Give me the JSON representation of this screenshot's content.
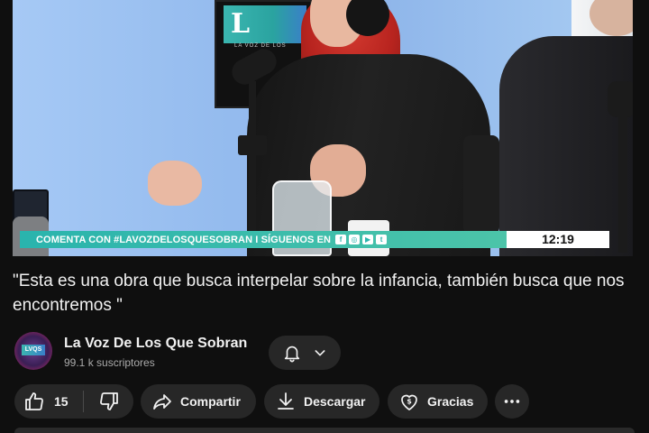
{
  "video": {
    "studio_logo_letters": "L",
    "studio_logo_subtitle": "LA VOZ DE LOS",
    "ticker_text": "COMENTA CON #LAVOZDELOSQUESOBRAN I SÍGUENOS EN",
    "ticker_social_icons": [
      "facebook-icon",
      "instagram-icon",
      "youtube-icon",
      "twitter-icon"
    ],
    "clock": "12:19",
    "accent_color": "#2ab4ad"
  },
  "title": "\"Esta es una obra que busca interpelar sobre la infancia, también busca que nos encontremos \"",
  "channel": {
    "name": "La Voz De Los Que Sobran",
    "subscribers": "99.1 k suscriptores",
    "avatar_text": "LVQS"
  },
  "actions": {
    "like_count": "15",
    "share_label": "Compartir",
    "download_label": "Descargar",
    "thanks_label": "Gracias"
  }
}
